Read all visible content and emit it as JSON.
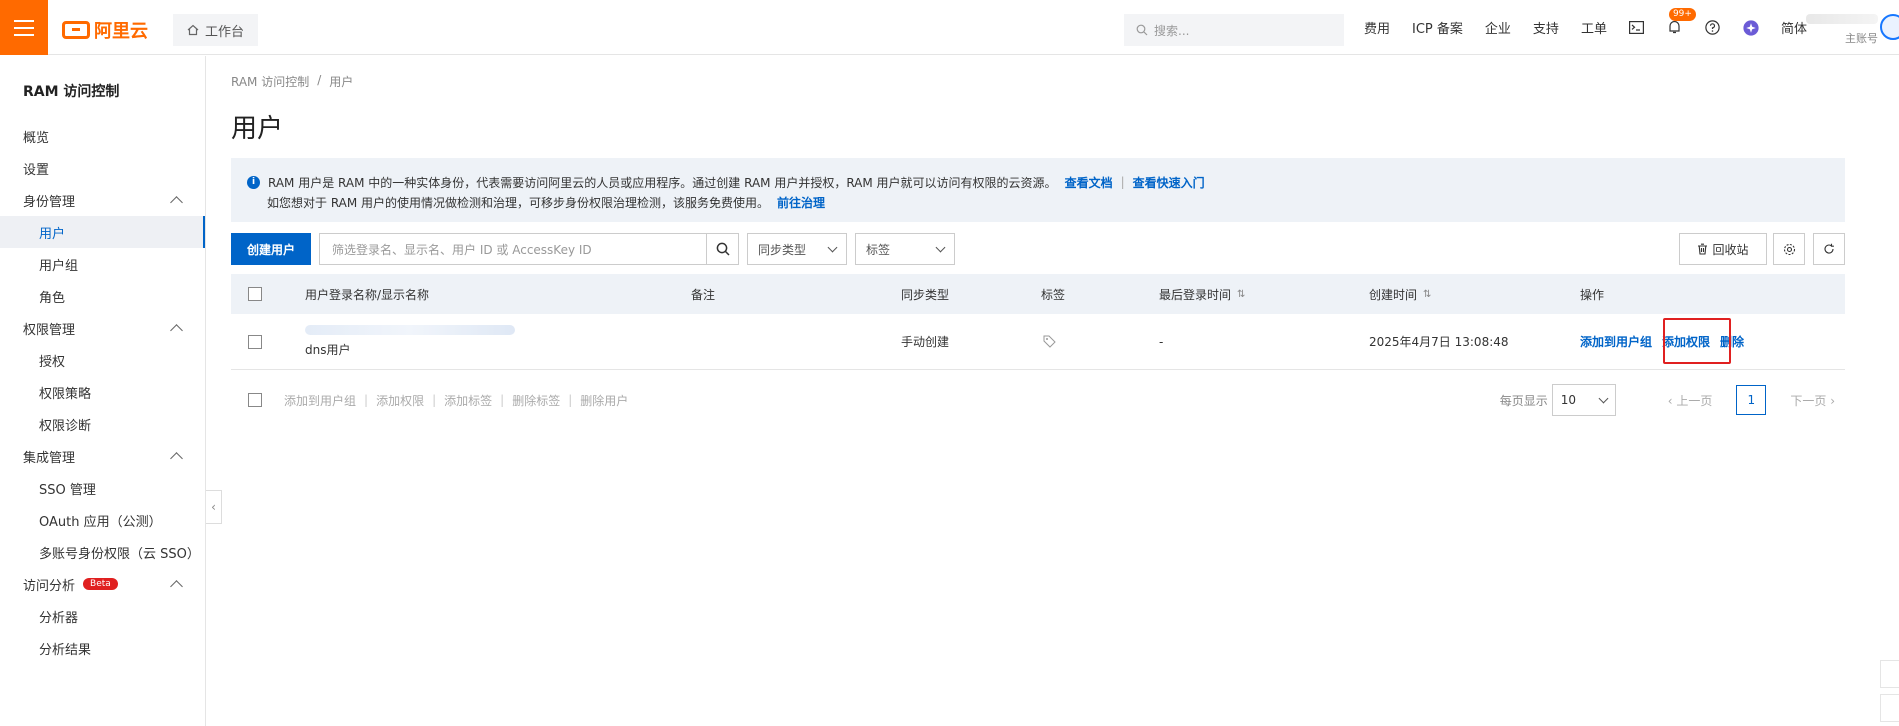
{
  "topbar": {
    "brand": "阿里云",
    "workbench_label": "工作台",
    "search_placeholder": "搜索...",
    "nav": [
      "费用",
      "ICP 备案",
      "企业",
      "支持",
      "工单"
    ],
    "notification_badge": "99+",
    "language": "简体",
    "account_label": "主账号"
  },
  "sidebar": {
    "title": "RAM 访问控制",
    "items": [
      {
        "label": "概览",
        "level": 0
      },
      {
        "label": "设置",
        "level": 0
      },
      {
        "label": "身份管理",
        "level": 0,
        "group": true
      },
      {
        "label": "用户",
        "level": 1,
        "active": true
      },
      {
        "label": "用户组",
        "level": 1
      },
      {
        "label": "角色",
        "level": 1
      },
      {
        "label": "权限管理",
        "level": 0,
        "group": true
      },
      {
        "label": "授权",
        "level": 1
      },
      {
        "label": "权限策略",
        "level": 1
      },
      {
        "label": "权限诊断",
        "level": 1
      },
      {
        "label": "集成管理",
        "level": 0,
        "group": true
      },
      {
        "label": "SSO 管理",
        "level": 1
      },
      {
        "label": "OAuth 应用（公测）",
        "level": 1
      },
      {
        "label": "多账号身份权限（云 SSO）",
        "level": 1
      },
      {
        "label": "访问分析",
        "level": 0,
        "group": true,
        "badge": "Beta"
      },
      {
        "label": "分析器",
        "level": 1
      },
      {
        "label": "分析结果",
        "level": 1
      }
    ]
  },
  "breadcrumb": [
    "RAM 访问控制",
    "/",
    "用户"
  ],
  "page_title": "用户",
  "notice": {
    "line1": "RAM 用户是 RAM 中的一种实体身份，代表需要访问阿里云的人员或应用程序。通过创建 RAM 用户并授权，RAM 用户就可以访问有权限的云资源。",
    "link1": "查看文档",
    "sep": "|",
    "link2": "查看快速入门",
    "line2": "如您想对于 RAM 用户的使用情况做检测和治理，可移步身份权限治理检测，该服务免费使用。",
    "link3": "前往治理"
  },
  "toolbar": {
    "create_user": "创建用户",
    "filter_placeholder": "筛选登录名、显示名、用户 ID 或 AccessKey ID",
    "sync_type": "同步类型",
    "tags": "标签",
    "recycle_bin": "回收站"
  },
  "table": {
    "columns": [
      "用户登录名称/显示名称",
      "备注",
      "同步类型",
      "标签",
      "最后登录时间",
      "创建时间",
      "操作"
    ],
    "rows": [
      {
        "display_name": "dns用户",
        "note": "",
        "sync_type": "手动创建",
        "last_login": "-",
        "created": "2025年4月7日 13:08:48",
        "actions": [
          "添加到用户组",
          "添加权限",
          "删除"
        ]
      }
    ]
  },
  "batch_actions": [
    "添加到用户组",
    "添加权限",
    "添加标签",
    "删除标签",
    "删除用户"
  ],
  "pager": {
    "per_page_label": "每页显示",
    "per_page": "10",
    "prev": "上一页",
    "current": "1",
    "next": "下一页"
  },
  "colors": {
    "accent": "#ff6a00",
    "primary": "#0064c8",
    "highlight": "#e02020"
  }
}
